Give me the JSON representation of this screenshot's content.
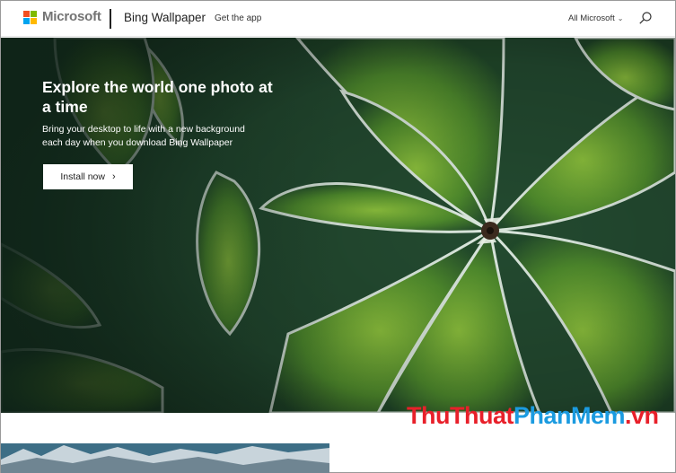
{
  "header": {
    "brand": "Microsoft",
    "product": "Bing Wallpaper",
    "get_app": "Get the app",
    "all_microsoft": "All Microsoft",
    "chevron": "⌄"
  },
  "hero": {
    "title": "Explore the world one photo at a time",
    "subtitle": "Bring your desktop to life with a new background each day when you download Bing Wallpaper",
    "install_label": "Install now",
    "install_arrow": "›"
  },
  "watermark": {
    "part1": "ThuThuat",
    "part2": "PhanMem",
    "part3": ".vn"
  },
  "colors": {
    "ms_red": "#f25022",
    "ms_green": "#7fba00",
    "ms_blue": "#00a4ef",
    "ms_yellow": "#ffb900",
    "watermark_red": "#e8202a",
    "watermark_blue": "#1b9be0"
  },
  "icons": {
    "logo": "microsoft-logo-icon",
    "search": "search-icon"
  }
}
